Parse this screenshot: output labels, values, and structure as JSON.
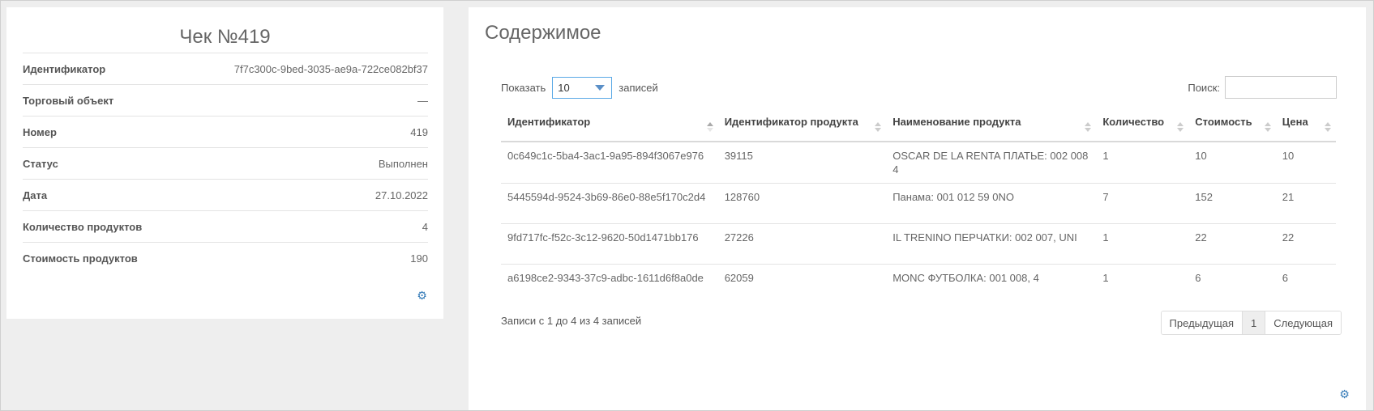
{
  "receipt": {
    "title": "Чек №419",
    "properties": [
      {
        "label": "Идентификатор",
        "value": "7f7c300c-9bed-3035-ae9a-722ce082bf37"
      },
      {
        "label": "Торговый объект",
        "value": "—"
      },
      {
        "label": "Номер",
        "value": "419"
      },
      {
        "label": "Статус",
        "value": "Выполнен"
      },
      {
        "label": "Дата",
        "value": "27.10.2022"
      },
      {
        "label": "Количество продуктов",
        "value": "4"
      },
      {
        "label": "Стоимость продуктов",
        "value": "190"
      }
    ]
  },
  "contents": {
    "title": "Содержимое",
    "length": {
      "show_label": "Показать",
      "selected": "10",
      "records_label": "записей"
    },
    "search": {
      "label": "Поиск:",
      "value": ""
    },
    "columns": [
      "Идентификатор",
      "Идентификатор продукта",
      "Наименование продукта",
      "Количество",
      "Стоимость",
      "Цена"
    ],
    "rows": [
      [
        "0c649c1c-5ba4-3ac1-9a95-894f3067e976",
        "39115",
        "OSCAR DE LA RENTA ПЛАТЬЕ: 002 008 4",
        "1",
        "10",
        "10"
      ],
      [
        "5445594d-9524-3b69-86e0-88e5f170c2d4",
        "128760",
        "Панама: 001 012 59 0NO",
        "7",
        "152",
        "21"
      ],
      [
        "9fd717fc-f52c-3c12-9620-50d1471bb176",
        "27226",
        "IL TRENINO ПЕРЧАТКИ: 002 007, UNI",
        "1",
        "22",
        "22"
      ],
      [
        "a6198ce2-9343-37c9-adbc-1611d6f8a0de",
        "62059",
        "MONC ФУТБОЛКА: 001 008, 4",
        "1",
        "6",
        "6"
      ]
    ],
    "info": "Записи с 1 до 4 из 4 записей",
    "pagination": {
      "prev": "Предыдущая",
      "current": "1",
      "next": "Следующая"
    }
  },
  "colors": {
    "accent": "#337ab7",
    "select_border": "#5aa9e6"
  }
}
